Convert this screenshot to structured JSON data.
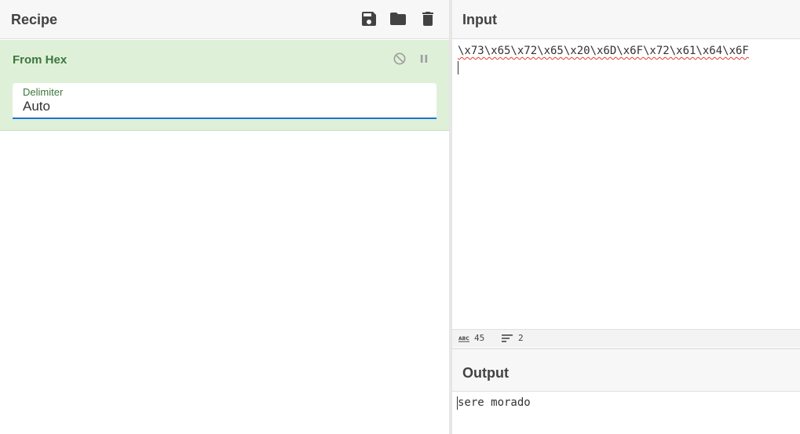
{
  "recipe": {
    "title": "Recipe",
    "header_icons": [
      "save-icon",
      "folder-icon",
      "trash-icon"
    ],
    "operation": {
      "name": "From Hex",
      "icons": [
        "disable-icon",
        "pause-icon"
      ],
      "argument": {
        "label": "Delimiter",
        "value": "Auto"
      }
    }
  },
  "input": {
    "title": "Input",
    "text": "\\x73\\x65\\x72\\x65\\x20\\x6D\\x6F\\x72\\x61\\x64\\x6F",
    "stats": {
      "length": "45",
      "lines": "2"
    }
  },
  "output": {
    "title": "Output",
    "text": "sere morado"
  },
  "colors": {
    "operation_bg": "#dff0d8",
    "operation_text": "#3c763d",
    "focus_underline": "#1976d2",
    "header_bg": "#f7f7f7"
  }
}
